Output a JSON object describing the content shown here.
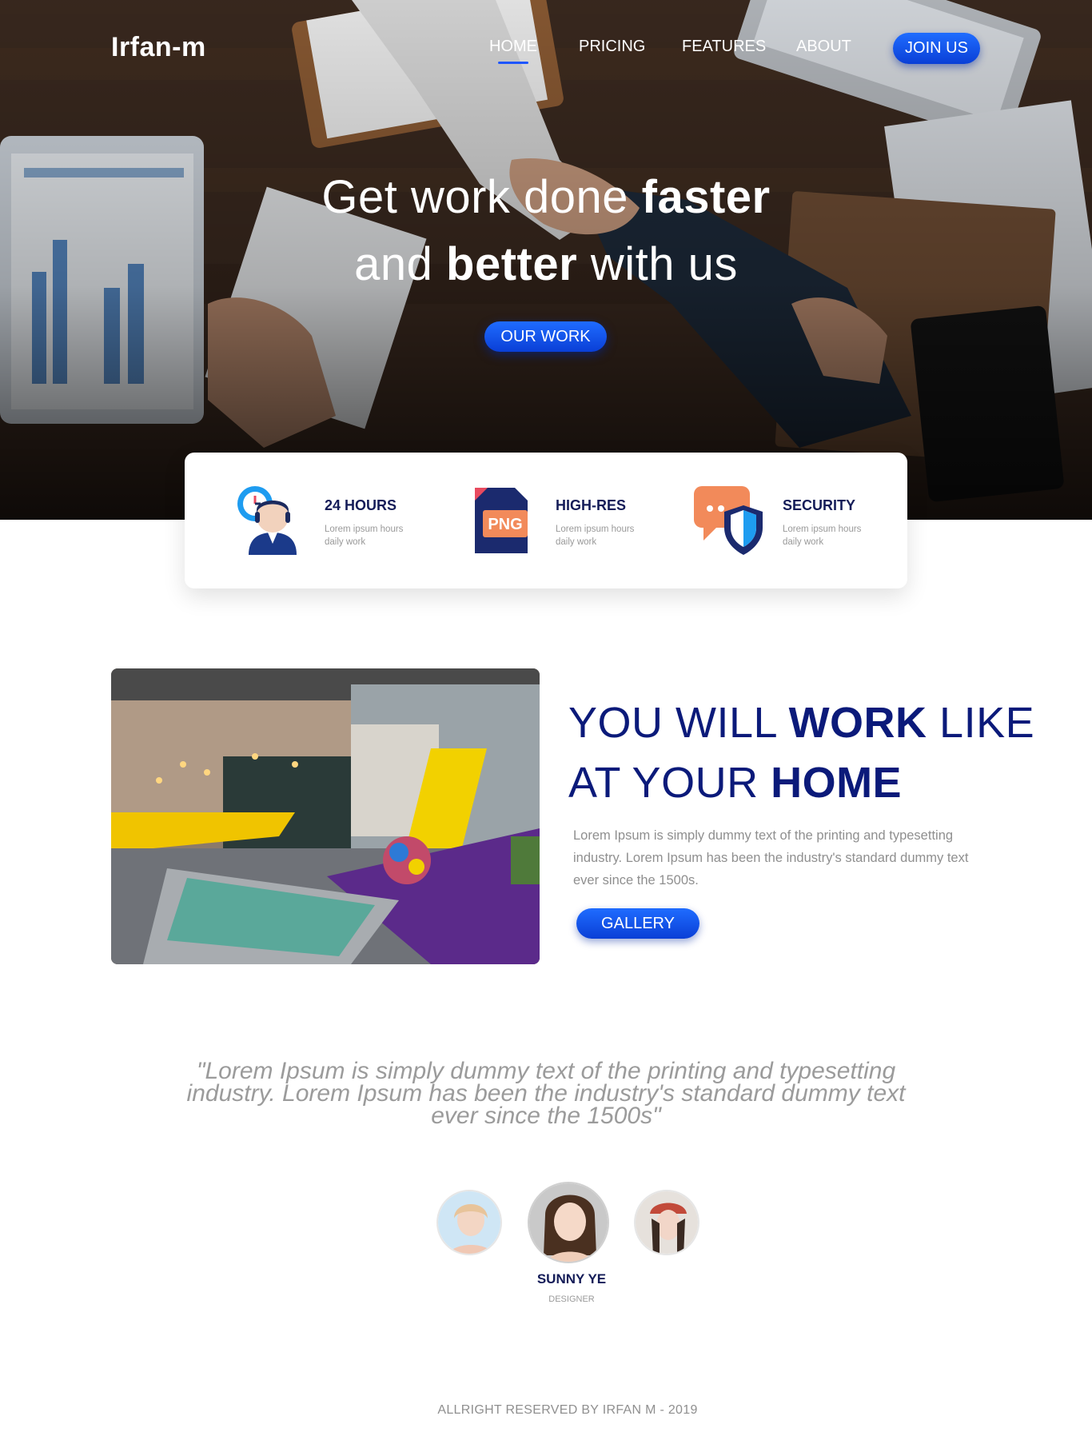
{
  "brand": {
    "logo": "Irfan-m"
  },
  "nav": {
    "items": [
      {
        "label": "HOME",
        "active": true
      },
      {
        "label": "PRICING",
        "active": false
      },
      {
        "label": "FEATURES",
        "active": false
      },
      {
        "label": "ABOUT",
        "active": false
      }
    ],
    "join_label": "JOIN US"
  },
  "hero": {
    "line1_light": "Get work done ",
    "line1_bold": "faster",
    "line2_light_a": "and ",
    "line2_bold": "better",
    "line2_light_b": " with us",
    "cta_label": "OUR WORK"
  },
  "features": [
    {
      "title": "24 HOURS",
      "desc": "Lorem ipsum hours daily work",
      "icon": "support-agent-clock-icon"
    },
    {
      "title": "HIGH-RES",
      "desc": "Lorem ipsum hours daily work",
      "icon": "png-file-icon",
      "icon_text": "PNG"
    },
    {
      "title": "SECURITY",
      "desc": "Lorem ipsum hours daily work",
      "icon": "chat-shield-icon"
    }
  ],
  "about": {
    "title_l1_light_a": "YOU WILL ",
    "title_l1_bold": "WORK",
    "title_l1_light_b": " LIKE",
    "title_l2_light": "AT YOUR ",
    "title_l2_bold": "HOME",
    "text": "Lorem Ipsum is simply dummy text of the printing and typesetting industry. Lorem Ipsum has been the industry's standard dummy text ever since the 1500s.",
    "cta_label": "GALLERY"
  },
  "testimonial": {
    "quote_l1": "\"Lorem Ipsum is simply dummy text of the printing and typesetting",
    "quote_l2": "industry. Lorem Ipsum has been the industry's standard dummy text",
    "quote_l3": "ever since the 1500s\"",
    "name": "SUNNY YE",
    "role": "DESIGNER"
  },
  "footer": {
    "text": "ALLRIGHT RESERVED BY IRFAN M - 2019"
  },
  "colors": {
    "accent": "#1e56ff",
    "navy": "#0b1a7a",
    "text_muted": "#8f8f8f"
  }
}
